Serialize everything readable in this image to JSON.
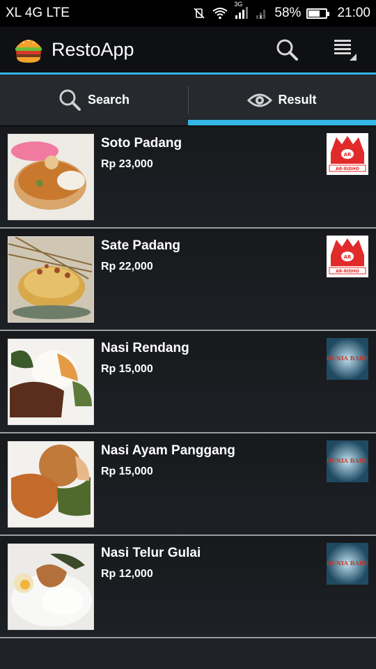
{
  "status_bar": {
    "carrier": "XL 4G LTE",
    "network_type": "3G",
    "battery": "58%",
    "battery_level": 0.58,
    "time": "21:00"
  },
  "app": {
    "title": "RestoApp",
    "logo_icon": "burger-icon"
  },
  "tabs": [
    {
      "label": "Search",
      "icon": "search-icon",
      "active": false
    },
    {
      "label": "Result",
      "icon": "eye-icon",
      "active": true
    }
  ],
  "results": [
    {
      "name": "Soto Padang",
      "price": "Rp 23,000",
      "restaurant_logo": "AR-RIDHO"
    },
    {
      "name": "Sate Padang",
      "price": "Rp 22,000",
      "restaurant_logo": "AR-RIDHO"
    },
    {
      "name": "Nasi Rendang",
      "price": "Rp 15,000",
      "restaurant_logo": "DUNIA BARU"
    },
    {
      "name": "Nasi Ayam Panggang",
      "price": "Rp 15,000",
      "restaurant_logo": "DUNIA BARU"
    },
    {
      "name": "Nasi Telur Gulai",
      "price": "Rp 12,000",
      "restaurant_logo": "DUNIA BARU"
    }
  ],
  "colors": {
    "accent": "#33b5e5",
    "background": "#1e2126"
  }
}
